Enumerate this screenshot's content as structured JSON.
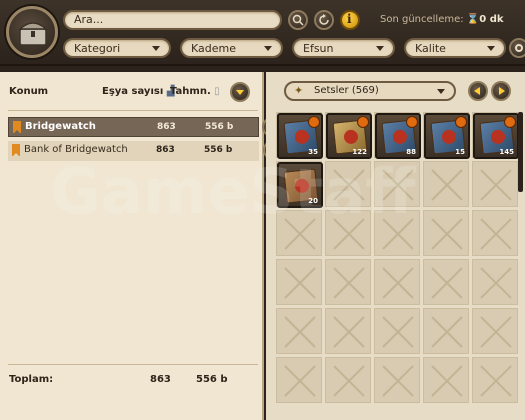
{
  "header": {
    "search_placeholder": "Ara...",
    "update_label": "Son güncelleme:",
    "update_value": "0 dk",
    "info_label": "i"
  },
  "filters": [
    "Kategori",
    "Kademe",
    "Efsun",
    "Kalite"
  ],
  "table": {
    "columns": [
      "Konum",
      "Eşya sayısı",
      "Tahmn."
    ],
    "rows": [
      {
        "name": "Bridgewatch",
        "count": "863",
        "value": "556 b",
        "selected": true
      },
      {
        "name": "Bank of Bridgewatch",
        "count": "863",
        "value": "556 b",
        "selected": false
      }
    ],
    "total_label": "Toplam:",
    "total_count": "863",
    "total_value": "556 b"
  },
  "sets": {
    "label": "Setsler (569)",
    "items": [
      {
        "qty": "35",
        "color": "blue"
      },
      {
        "qty": "122",
        "color": "gold"
      },
      {
        "qty": "88",
        "color": "blue"
      },
      {
        "qty": "15",
        "color": "blue"
      },
      {
        "qty": "145",
        "color": "blue"
      },
      {
        "qty": "20",
        "color": "brown"
      }
    ]
  },
  "watermark": "GameStaff",
  "colors": {
    "accent": "#ffcc33",
    "selected_row": "#766655",
    "bookmark": "#e08a1f"
  }
}
